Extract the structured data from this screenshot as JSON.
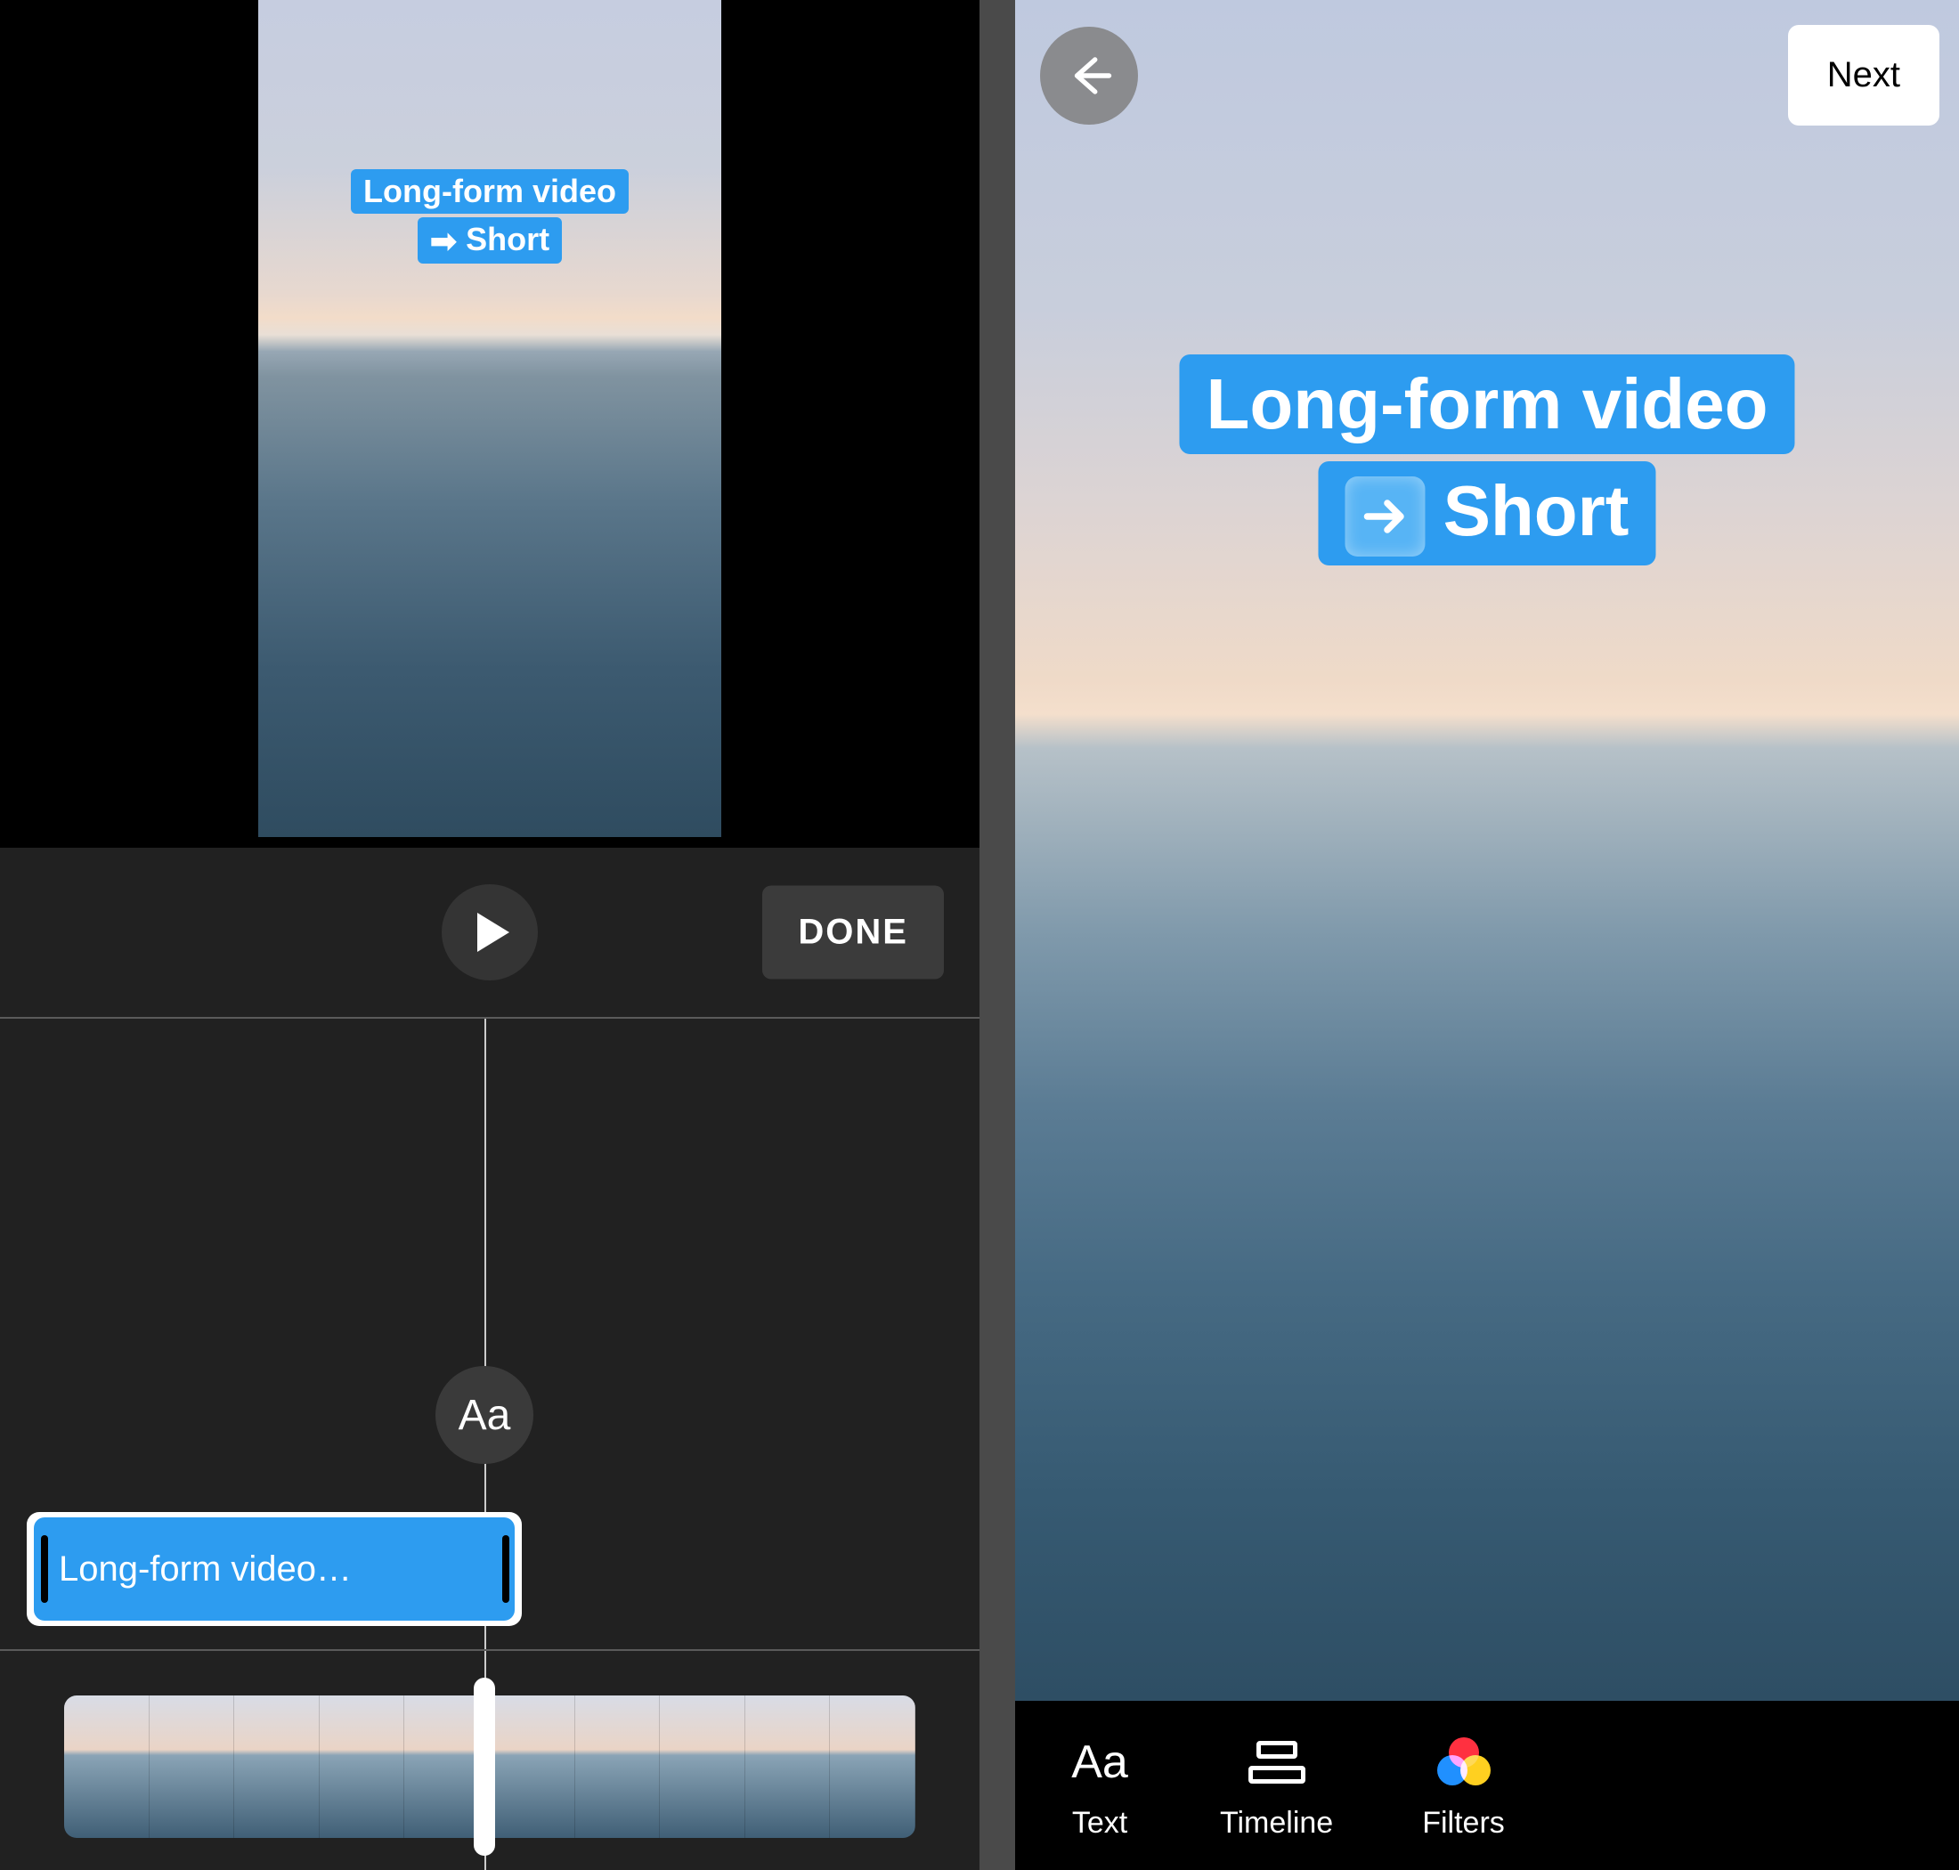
{
  "left": {
    "overlay": {
      "line1": "Long-form video",
      "line2": "Short",
      "arrow": "➡"
    },
    "play_label": "Play",
    "done_label": "DONE",
    "text_track_badge": "Aa",
    "clip_label": "Long-form video…"
  },
  "right": {
    "back_label": "Back",
    "next_label": "Next",
    "overlay": {
      "line1": "Long-form video",
      "line2": "Short",
      "arrow": "➡"
    },
    "tools": {
      "text": {
        "label": "Text",
        "glyph": "Aa"
      },
      "timeline": {
        "label": "Timeline"
      },
      "filters": {
        "label": "Filters"
      }
    }
  }
}
